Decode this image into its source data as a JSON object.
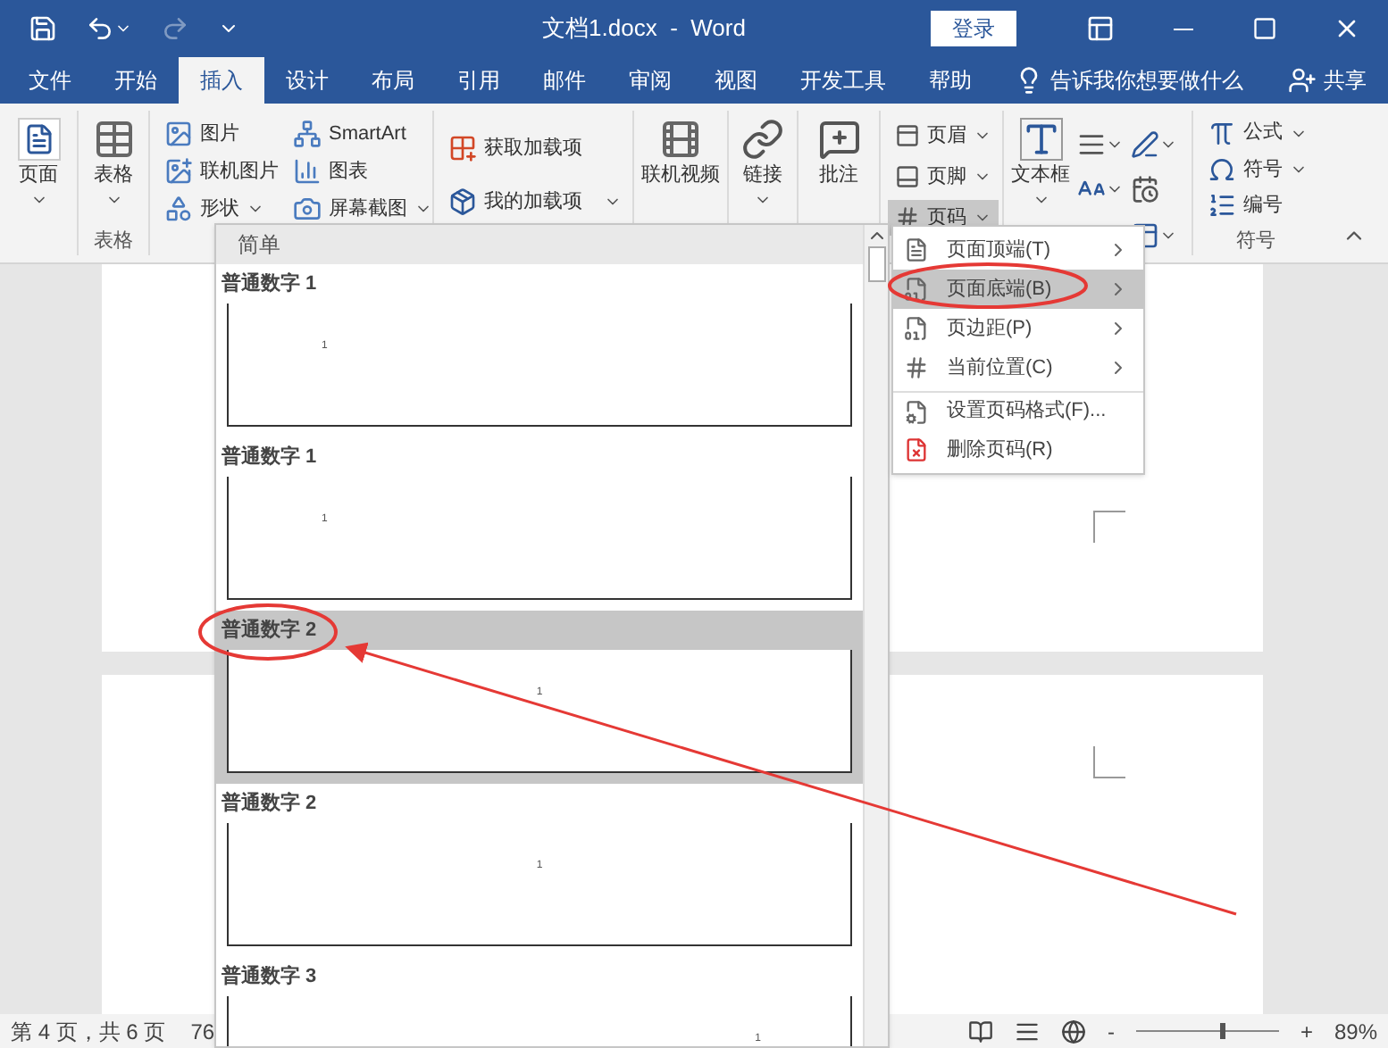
{
  "title_bar": {
    "title": "文档1.docx  -  Word",
    "sign_in": "登录",
    "redo_disabled": true
  },
  "tabs": [
    {
      "label": "文件",
      "selected": false
    },
    {
      "label": "开始",
      "selected": false
    },
    {
      "label": "插入",
      "selected": true
    },
    {
      "label": "设计",
      "selected": false
    },
    {
      "label": "布局",
      "selected": false
    },
    {
      "label": "引用",
      "selected": false
    },
    {
      "label": "邮件",
      "selected": false
    },
    {
      "label": "审阅",
      "selected": false
    },
    {
      "label": "视图",
      "selected": false
    },
    {
      "label": "开发工具",
      "selected": false
    },
    {
      "label": "帮助",
      "selected": false
    }
  ],
  "tell_me": "告诉我你想要做什么",
  "share": "共享",
  "ribbon": {
    "pages": "页面",
    "tables": {
      "button": "表格",
      "group_label": "表格"
    },
    "illustrations": [
      [
        {
          "label": "图片",
          "dropdown": false
        },
        {
          "label": "联机图片",
          "dropdown": false
        },
        {
          "label": "形状",
          "dropdown": true
        }
      ],
      [
        {
          "label": "SmartArt",
          "dropdown": false
        },
        {
          "label": "图表",
          "dropdown": false
        },
        {
          "label": "屏幕截图",
          "dropdown": true
        }
      ]
    ],
    "add_ins": [
      {
        "label": "获取加载项",
        "dropdown": false
      },
      {
        "label": "我的加载项",
        "dropdown": true
      }
    ],
    "online_video": "联机视频",
    "link": "链接",
    "comment": "批注",
    "header_footer": [
      {
        "label": "页眉",
        "selected": false
      },
      {
        "label": "页脚",
        "selected": false
      },
      {
        "label": "页码",
        "selected": true
      }
    ],
    "text_box": "文本框",
    "symbols": {
      "items": [
        {
          "label": "公式",
          "dropdown": true
        },
        {
          "label": "符号",
          "dropdown": true
        },
        {
          "label": "编号",
          "dropdown": false
        }
      ],
      "group_label": "符号"
    }
  },
  "gallery": {
    "header": "简单",
    "items": [
      {
        "label": "普通数字 1",
        "kind": "left",
        "page_number": "1",
        "selected": false
      },
      {
        "label": "普通数字 1",
        "kind": "left",
        "page_number": "1",
        "selected": false
      },
      {
        "label": "普通数字 2",
        "kind": "center",
        "page_number": "1",
        "selected": true
      },
      {
        "label": "普通数字 2",
        "kind": "center",
        "page_number": "1",
        "selected": false
      },
      {
        "label": "普通数字 3",
        "kind": "right",
        "page_number": "1",
        "selected": false
      }
    ]
  },
  "page_number_menu": [
    {
      "label": "页面顶端(T)",
      "has_submenu": true,
      "selected": false,
      "separator_before": false
    },
    {
      "label": "页面底端(B)",
      "has_submenu": true,
      "selected": true,
      "separator_before": false
    },
    {
      "label": "页边距(P)",
      "has_submenu": true,
      "selected": false,
      "separator_before": false
    },
    {
      "label": "当前位置(C)",
      "has_submenu": true,
      "selected": false,
      "separator_before": false
    },
    {
      "label": "设置页码格式(F)...",
      "has_submenu": false,
      "selected": false,
      "separator_before": true
    },
    {
      "label": "删除页码(R)",
      "has_submenu": false,
      "selected": false,
      "separator_before": false
    }
  ],
  "status_bar": {
    "page_info": "第 4 页，共 6 页",
    "word_count": "76",
    "zoom_out": "-",
    "zoom_slider": {
      "level": 0.6
    },
    "zoom_in": "+",
    "zoom": "89%"
  }
}
